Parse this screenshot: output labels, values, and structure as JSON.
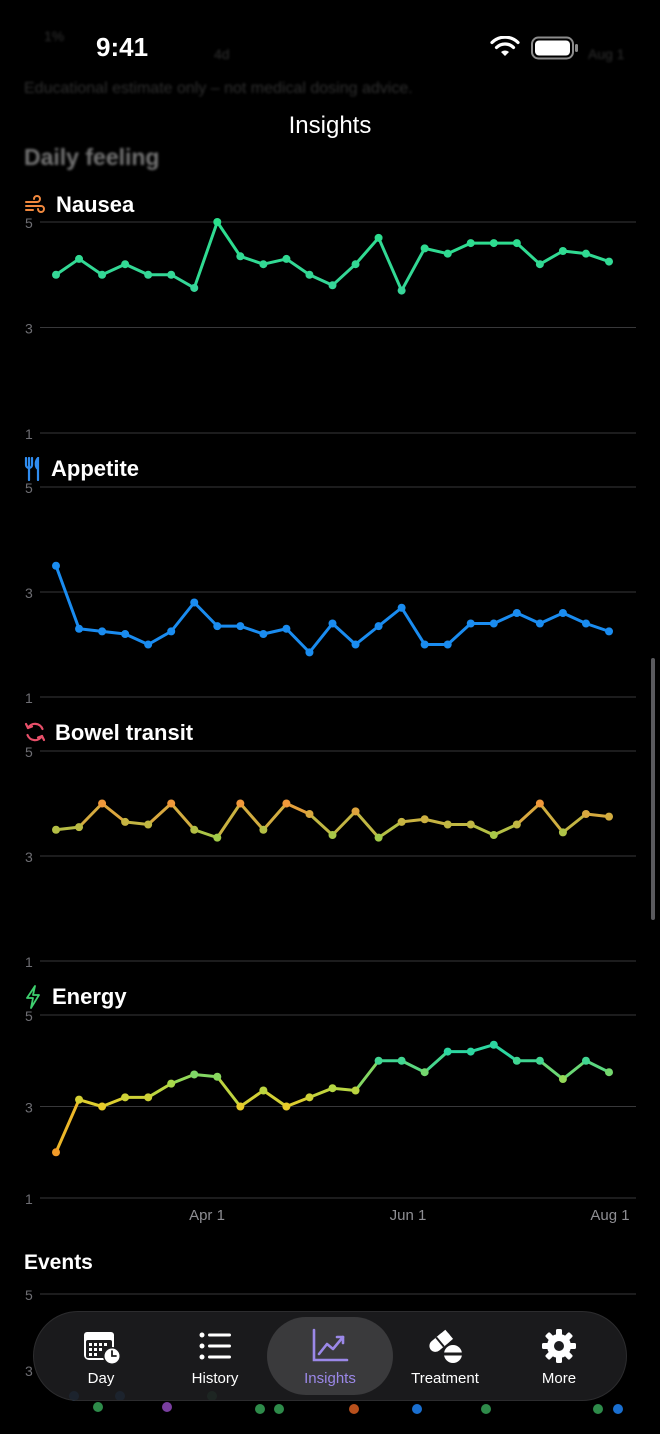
{
  "status_bar": {
    "time": "9:41"
  },
  "background_scroll": {
    "line1_left": "1%",
    "line1_mid": "4d",
    "line1_right": "Aug 1",
    "disclaimer": "Educational estimate only – not medical dosing advice.",
    "heading": "Daily feeling"
  },
  "nav": {
    "title": "Insights"
  },
  "colors": {
    "background": "#000000",
    "accent": "#9b88e8",
    "grid": "#3a3a3c"
  },
  "charts": [
    {
      "title": "Nausea",
      "icon": "wind-icon",
      "values": [
        4.0,
        4.3,
        4.0,
        4.2,
        4.0,
        4.0,
        3.75,
        5.0,
        4.35,
        4.2,
        4.3,
        4.0,
        3.8,
        4.2,
        4.7,
        3.7,
        4.5,
        4.4,
        4.6,
        4.6,
        4.6,
        4.2,
        4.45,
        4.4,
        4.25
      ]
    },
    {
      "title": "Appetite",
      "icon": "fork-knife-icon",
      "values": [
        3.5,
        2.3,
        2.25,
        2.2,
        2.0,
        2.25,
        2.8,
        2.35,
        2.35,
        2.2,
        2.3,
        1.85,
        2.4,
        2.0,
        2.35,
        2.7,
        2.0,
        2.0,
        2.4,
        2.4,
        2.6,
        2.4,
        2.6,
        2.4,
        2.25
      ]
    },
    {
      "title": "Bowel transit",
      "icon": "cycle-arrows-icon",
      "values": [
        3.5,
        3.55,
        4.0,
        3.65,
        3.6,
        4.0,
        3.5,
        3.35,
        4.0,
        3.5,
        4.0,
        3.8,
        3.4,
        3.85,
        3.35,
        3.65,
        3.7,
        3.6,
        3.6,
        3.4,
        3.6,
        4.0,
        3.45,
        3.8,
        3.75
      ]
    },
    {
      "title": "Energy",
      "icon": "bolt-icon",
      "values": [
        2.0,
        3.15,
        3.0,
        3.2,
        3.2,
        3.5,
        3.7,
        3.65,
        3.0,
        3.35,
        3.0,
        3.2,
        3.4,
        3.35,
        4.0,
        4.0,
        3.75,
        4.2,
        4.2,
        4.35,
        4.0,
        4.0,
        3.6,
        4.0,
        3.75
      ]
    }
  ],
  "axis": {
    "y_ticks": [
      "5",
      "3",
      "1"
    ],
    "ylim": [
      1,
      5
    ],
    "x_ticks": [
      "Apr 1",
      "Jun 1",
      "Aug 1"
    ]
  },
  "events": {
    "title": "Events",
    "y_top_tick": "5",
    "y_mid_tick": "3"
  },
  "tabs": [
    {
      "label": "Day",
      "icon": "calendar-clock-icon",
      "active": false
    },
    {
      "label": "History",
      "icon": "list-icon",
      "active": false
    },
    {
      "label": "Insights",
      "icon": "chart-line-icon",
      "active": true
    },
    {
      "label": "Treatment",
      "icon": "pills-icon",
      "active": false
    },
    {
      "label": "More",
      "icon": "gear-icon",
      "active": false
    }
  ]
}
